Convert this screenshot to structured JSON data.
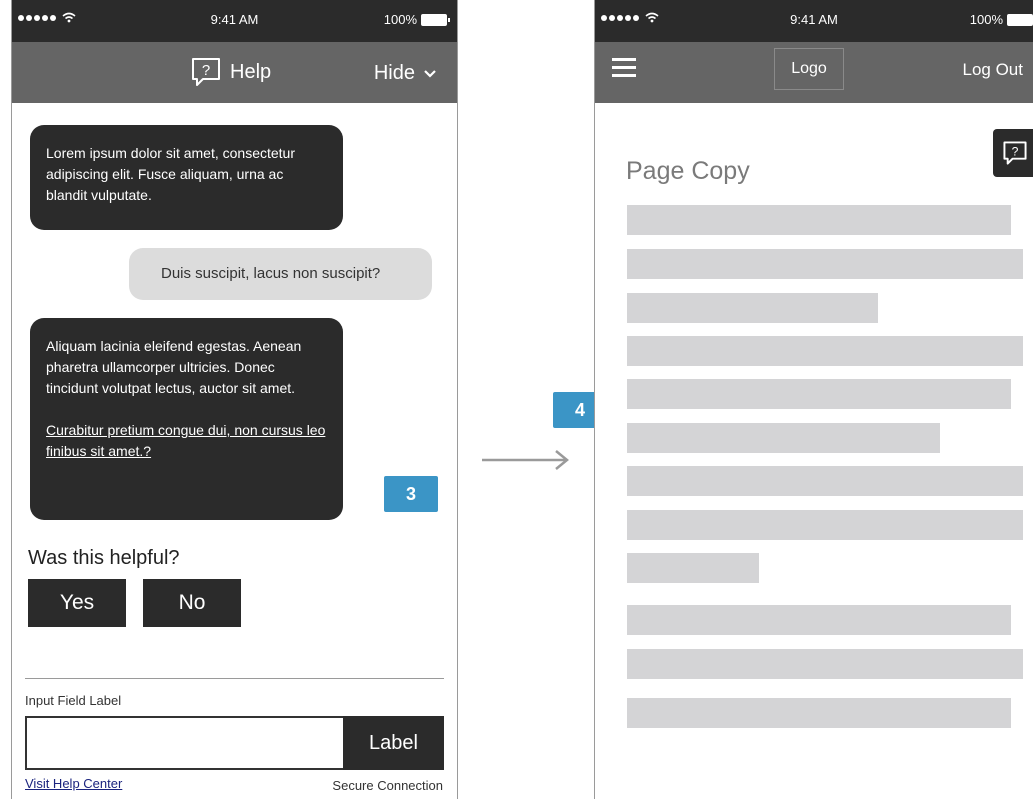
{
  "status_bar": {
    "time": "9:41 AM",
    "battery": "100%"
  },
  "chat_screen": {
    "header": {
      "title": "Help",
      "hide_label": "Hide"
    },
    "messages": [
      {
        "from": "bot",
        "text": "Lorem ipsum dolor sit amet, consectetur adipiscing elit. Fusce aliquam, urna ac blandit vulputate."
      },
      {
        "from": "user",
        "text": "Duis suscipit, lacus non suscipit?"
      },
      {
        "from": "bot",
        "text": "Aliquam lacinia eleifend egestas. Aenean pharetra ullamcorper ultricies. Donec tincidunt volutpat lectus, auctor sit amet.",
        "link": "Curabitur pretium congue dui, non cursus leo finibus sit amet.?"
      }
    ],
    "callout": "3",
    "feedback": {
      "question": "Was this helpful?",
      "yes": "Yes",
      "no": "No"
    },
    "input": {
      "label": "Input Field Label",
      "value": "",
      "button": "Label"
    },
    "footer": {
      "help_link": "Visit Help Center",
      "secure": "Secure Connection"
    }
  },
  "page_screen": {
    "header": {
      "logo": "Logo",
      "logout": "Log Out"
    },
    "callout": "4",
    "page_title": "Page Copy",
    "placeholder_line_count": 12
  },
  "colors": {
    "dark": "#2b2b2b",
    "header_gray": "#656565",
    "callout_blue": "#3b95c6",
    "placeholder": "#d4d4d6"
  },
  "icons": {
    "help": "help-speech-bubble-icon",
    "hide": "chevron-down-icon",
    "menu": "hamburger-menu-icon",
    "flow": "right-arrow-icon"
  }
}
